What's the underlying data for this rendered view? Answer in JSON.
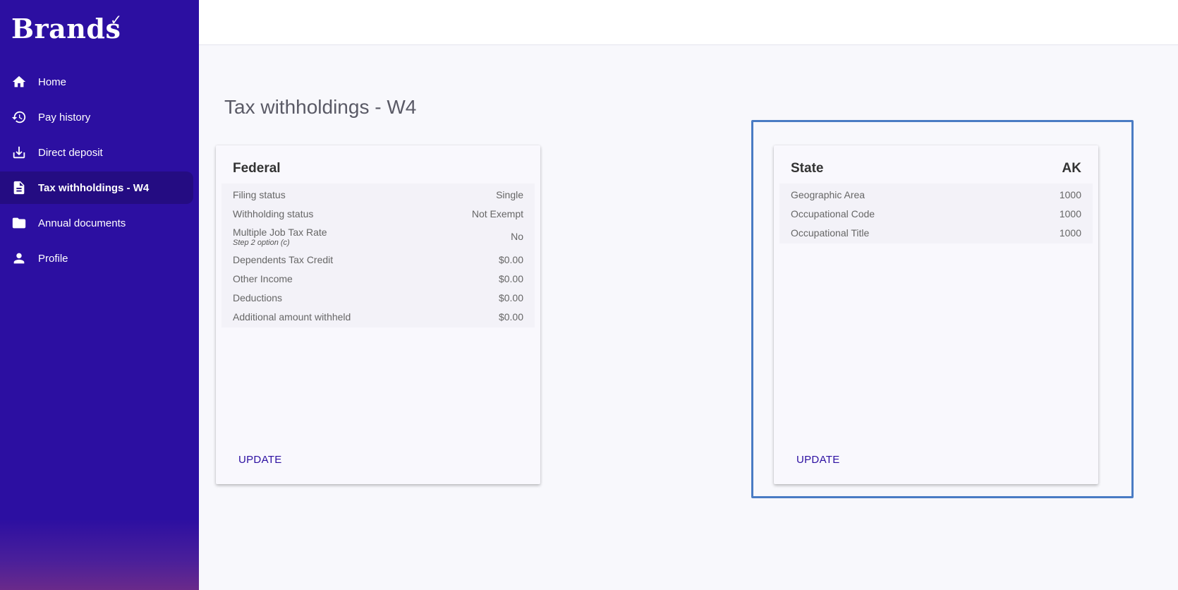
{
  "brand": {
    "name": "Brands",
    "check": "✓"
  },
  "nav": [
    {
      "label": "Home",
      "icon": "home-icon"
    },
    {
      "label": "Pay history",
      "icon": "history-icon"
    },
    {
      "label": "Direct deposit",
      "icon": "download-icon"
    },
    {
      "label": "Tax withholdings - W4",
      "icon": "document-icon",
      "active": true
    },
    {
      "label": "Annual documents",
      "icon": "folder-icon"
    },
    {
      "label": "Profile",
      "icon": "person-icon"
    }
  ],
  "page": {
    "title": "Tax withholdings - W4"
  },
  "federal": {
    "title": "Federal",
    "rows": [
      {
        "label": "Filing status",
        "value": "Single"
      },
      {
        "label": "Withholding status",
        "value": "Not Exempt"
      },
      {
        "label": "Multiple Job Tax Rate",
        "sub": "Step 2 option (c)",
        "value": "No"
      },
      {
        "label": "Dependents Tax Credit",
        "value": "$0.00"
      },
      {
        "label": "Other Income",
        "value": "$0.00"
      },
      {
        "label": "Deductions",
        "value": "$0.00"
      },
      {
        "label": "Additional amount withheld",
        "value": "$0.00"
      }
    ],
    "update_label": "UPDATE"
  },
  "state": {
    "title": "State",
    "code": "AK",
    "rows": [
      {
        "label": "Geographic Area",
        "value": "1000"
      },
      {
        "label": "Occupational Code",
        "value": "1000"
      },
      {
        "label": "Occupational Title",
        "value": "1000"
      }
    ],
    "update_label": "UPDATE"
  },
  "colors": {
    "sidebar": "#2c0fa1",
    "accent": "#2c0fa1",
    "focus_outline": "#4a7cc4"
  }
}
